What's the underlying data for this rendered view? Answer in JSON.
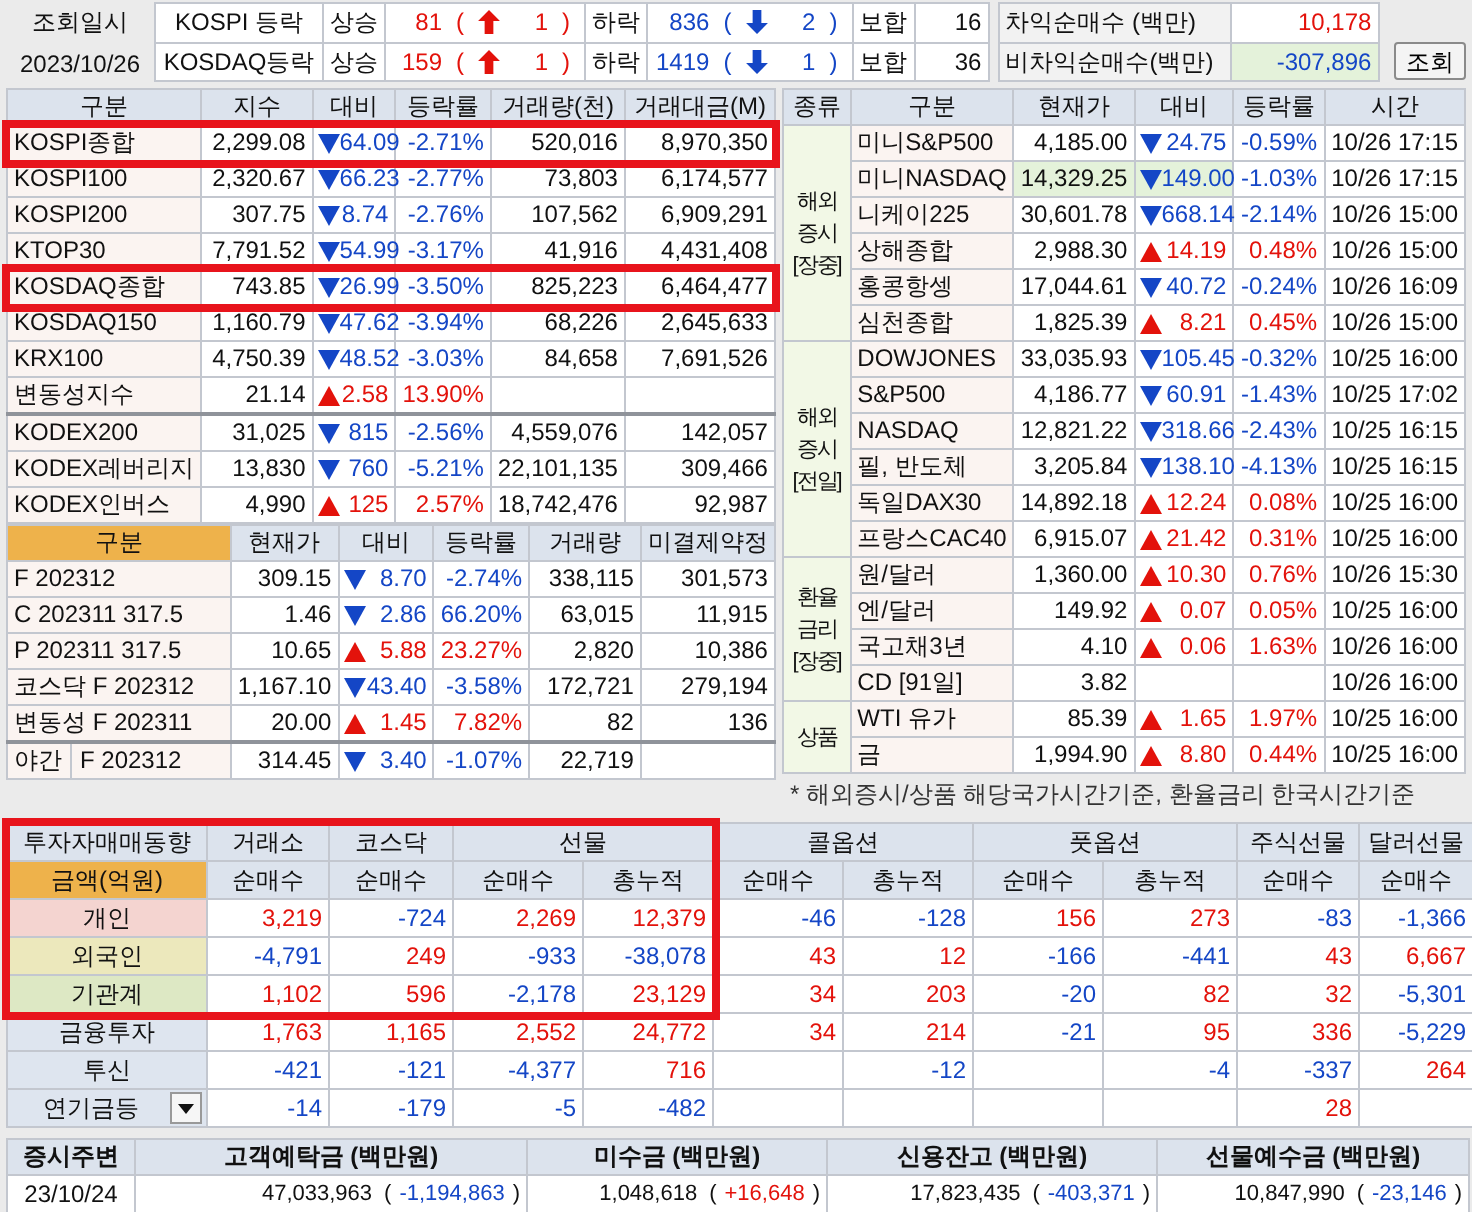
{
  "header": {
    "date_label": "조회일시",
    "date": "2023/10/26",
    "markets": [
      {
        "name": "KOSPI 등락",
        "up_label": "상승",
        "up": "81",
        "up_change": {
          "open": "(",
          "value": "1",
          "close": ")"
        },
        "down_label": "하락",
        "down": "836",
        "down_change": {
          "open": "(",
          "value": "2",
          "close": ")"
        },
        "flat_label": "보합",
        "flat": "16"
      },
      {
        "name": "KOSDAQ등락",
        "up_label": "상승",
        "up": "159",
        "up_change": {
          "open": "(",
          "value": "1",
          "close": ")"
        },
        "down_label": "하락",
        "down": "1419",
        "down_change": {
          "open": "(",
          "value": "1",
          "close": ")"
        },
        "flat_label": "보합",
        "flat": "36"
      }
    ],
    "arbitrage": [
      {
        "label": "차익순매수 (백만)",
        "value": "10,178",
        "rising": true,
        "highlighted": false
      },
      {
        "label": "비차익순매수(백만)",
        "value": "-307,896",
        "rising": false,
        "highlighted": true
      }
    ],
    "query_button": "조회"
  },
  "indices": {
    "columns": [
      "구분",
      "지수",
      "대비",
      "등락률",
      "거래량(천)",
      "거래대금(M)"
    ],
    "rows": [
      {
        "name": "KOSPI종합",
        "value": "2,299.08",
        "rising": false,
        "change": "64.09",
        "rate": "-2.71%",
        "volume": "520,016",
        "amount": "8,970,350",
        "highlighted": true,
        "separator": false
      },
      {
        "name": "KOSPI100",
        "value": "2,320.67",
        "rising": false,
        "change": "66.23",
        "rate": "-2.77%",
        "volume": "73,803",
        "amount": "6,174,577",
        "highlighted": false,
        "separator": false
      },
      {
        "name": "KOSPI200",
        "value": "307.75",
        "rising": false,
        "change": "8.74",
        "rate": "-2.76%",
        "volume": "107,562",
        "amount": "6,909,291",
        "highlighted": false,
        "separator": false
      },
      {
        "name": "KTOP30",
        "value": "7,791.52",
        "rising": false,
        "change": "54.99",
        "rate": "-3.17%",
        "volume": "41,916",
        "amount": "4,431,408",
        "highlighted": false,
        "separator": false
      },
      {
        "name": "KOSDAQ종합",
        "value": "743.85",
        "rising": false,
        "change": "26.99",
        "rate": "-3.50%",
        "volume": "825,223",
        "amount": "6,464,477",
        "highlighted": true,
        "separator": false
      },
      {
        "name": "KOSDAQ150",
        "value": "1,160.79",
        "rising": false,
        "change": "47.62",
        "rate": "-3.94%",
        "volume": "68,226",
        "amount": "2,645,633",
        "highlighted": false,
        "separator": false
      },
      {
        "name": "KRX100",
        "value": "4,750.39",
        "rising": false,
        "change": "48.52",
        "rate": "-3.03%",
        "volume": "84,658",
        "amount": "7,691,526",
        "highlighted": false,
        "separator": false
      },
      {
        "name": "변동성지수",
        "value": "21.14",
        "rising": true,
        "change": "2.58",
        "rate": "13.90%",
        "highlighted": false,
        "separator": false
      },
      {
        "name": "KODEX200",
        "value": "31,025",
        "rising": false,
        "change": "815",
        "rate": "-2.56%",
        "volume": "4,559,076",
        "amount": "142,057",
        "highlighted": false,
        "separator": true
      },
      {
        "name": "KODEX레버리지",
        "value": "13,830",
        "rising": false,
        "change": "760",
        "rate": "-5.21%",
        "volume": "22,101,135",
        "amount": "309,466",
        "highlighted": false,
        "separator": false
      },
      {
        "name": "KODEX인버스",
        "value": "4,990",
        "rising": true,
        "change": "125",
        "rate": "2.57%",
        "volume": "18,742,476",
        "amount": "92,987",
        "highlighted": false,
        "separator": false
      }
    ]
  },
  "futures": {
    "columns": [
      "구분",
      "현재가",
      "대비",
      "등락률",
      "거래량",
      "미결제약정"
    ],
    "rows": [
      {
        "name": "F 202312",
        "value": "309.15",
        "rising": false,
        "change": "8.70",
        "rate": "-2.74%",
        "volume": "338,115",
        "open_interest": "301,573",
        "separator": false
      },
      {
        "name": "C 202311 317.5",
        "value": "1.46",
        "rising": false,
        "change": "2.86",
        "rate": "66.20%",
        "volume": "63,015",
        "open_interest": "11,915",
        "separator": false
      },
      {
        "name": "P 202311 317.5",
        "value": "10.65",
        "rising": true,
        "change": "5.88",
        "rate": "23.27%",
        "volume": "2,820",
        "open_interest": "10,386",
        "separator": false
      },
      {
        "name": "코스닥 F 202312",
        "value": "1,167.10",
        "rising": false,
        "change": "43.40",
        "rate": "-3.58%",
        "volume": "172,721",
        "open_interest": "279,194",
        "separator": false
      },
      {
        "name": "변동성 F 202311",
        "value": "20.00",
        "rising": true,
        "change": "1.45",
        "rate": "7.82%",
        "volume": "82",
        "open_interest": "136",
        "separator": false
      },
      {
        "session": "야간",
        "name": "F 202312",
        "value": "314.45",
        "rising": false,
        "change": "3.40",
        "rate": "-1.07%",
        "volume": "22,719",
        "separator": true
      }
    ]
  },
  "global": {
    "columns": [
      "종류",
      "구분",
      "현재가",
      "대비",
      "등락률",
      "시간"
    ],
    "groups": [
      {
        "label": "해외\n증시\n[장중]",
        "rows": [
          {
            "name": "미니S&P500",
            "value": "4,185.00",
            "rising": false,
            "change": "24.75",
            "rate": "-0.59%",
            "time": "10/26 17:15",
            "flash": false
          },
          {
            "name": "미니NASDAQ",
            "value": "14,329.25",
            "rising": false,
            "change": "149.00",
            "rate": "-1.03%",
            "time": "10/26 17:15",
            "flash": true
          },
          {
            "name": "니케이225",
            "value": "30,601.78",
            "rising": false,
            "change": "668.14",
            "rate": "-2.14%",
            "time": "10/26 15:00",
            "flash": false
          },
          {
            "name": "상해종합",
            "value": "2,988.30",
            "rising": true,
            "change": "14.19",
            "rate": "0.48%",
            "time": "10/26 15:00",
            "flash": false
          },
          {
            "name": "홍콩항셍",
            "value": "17,044.61",
            "rising": false,
            "change": "40.72",
            "rate": "-0.24%",
            "time": "10/26 16:09",
            "flash": false
          },
          {
            "name": "심천종합",
            "value": "1,825.39",
            "rising": true,
            "change": "8.21",
            "rate": "0.45%",
            "time": "10/26 15:00",
            "flash": false
          }
        ]
      },
      {
        "label": "해외\n증시\n[전일]",
        "rows": [
          {
            "name": "DOWJONES",
            "value": "33,035.93",
            "rising": false,
            "change": "105.45",
            "rate": "-0.32%",
            "time": "10/25 16:00",
            "flash": false
          },
          {
            "name": "S&P500",
            "value": "4,186.77",
            "rising": false,
            "change": "60.91",
            "rate": "-1.43%",
            "time": "10/25 17:02",
            "flash": false
          },
          {
            "name": "NASDAQ",
            "value": "12,821.22",
            "rising": false,
            "change": "318.66",
            "rate": "-2.43%",
            "time": "10/25 16:15",
            "flash": false
          },
          {
            "name": "필, 반도체",
            "value": "3,205.84",
            "rising": false,
            "change": "138.10",
            "rate": "-4.13%",
            "time": "10/25 16:15",
            "flash": false
          },
          {
            "name": "독일DAX30",
            "value": "14,892.18",
            "rising": true,
            "change": "12.24",
            "rate": "0.08%",
            "time": "10/25 16:00",
            "flash": false
          },
          {
            "name": "프랑스CAC40",
            "value": "6,915.07",
            "rising": true,
            "change": "21.42",
            "rate": "0.31%",
            "time": "10/25 16:00",
            "flash": false
          }
        ]
      },
      {
        "label": "환율\n금리\n[장중]",
        "rows": [
          {
            "name": "원/달러",
            "value": "1,360.00",
            "rising": true,
            "change": "10.30",
            "rate": "0.76%",
            "time": "10/26 15:30",
            "flash": false
          },
          {
            "name": "엔/달러",
            "value": "149.92",
            "rising": true,
            "change": "0.07",
            "rate": "0.05%",
            "time": "10/25 16:00",
            "flash": false
          },
          {
            "name": "국고채3년",
            "value": "4.10",
            "rising": true,
            "change": "0.06",
            "rate": "1.63%",
            "time": "10/26 16:00",
            "flash": false
          },
          {
            "name": "CD [91일]",
            "value": "3.82",
            "time": "10/26 16:00",
            "flash": false
          }
        ]
      },
      {
        "label": "상품",
        "rows": [
          {
            "name": "WTI 유가",
            "value": "85.39",
            "rising": true,
            "change": "1.65",
            "rate": "1.97%",
            "time": "10/25 16:00",
            "flash": false
          },
          {
            "name": "금",
            "value": "1,994.90",
            "rising": true,
            "change": "8.80",
            "rate": "0.44%",
            "time": "10/25 16:00",
            "flash": false
          }
        ]
      }
    ],
    "note": "* 해외증시/상품 해당국가시간기준, 환율금리 한국시간기준"
  },
  "investor": {
    "title": "투자자매매동향",
    "unit": "금액(억원)",
    "highlighted": true,
    "groups": [
      {
        "label": "거래소",
        "columns": [
          "순매수"
        ]
      },
      {
        "label": "코스닥",
        "columns": [
          "순매수"
        ]
      },
      {
        "label": "선물",
        "columns": [
          "순매수",
          "총누적"
        ]
      },
      {
        "label": "콜옵션",
        "columns": [
          "순매수",
          "총누적"
        ]
      },
      {
        "label": "풋옵션",
        "columns": [
          "순매수",
          "총누적"
        ]
      },
      {
        "label": "주식선물",
        "columns": [
          "순매수"
        ]
      },
      {
        "label": "달러선물",
        "columns": [
          "순매수"
        ]
      }
    ],
    "rows": [
      {
        "name": "개인",
        "color": "#f4d4d0",
        "dropdown": false,
        "values": {
          "exchange_net": "3,219",
          "kosdaq_net": "-724",
          "futures_net": "2,269",
          "futures_total": "12,379",
          "call_net": "-46",
          "call_total": "-128",
          "put_net": "156",
          "put_total": "273",
          "stock_futures_net": "-83",
          "dollar_futures_net": "-1,366"
        }
      },
      {
        "name": "외국인",
        "color": "#ece8bc",
        "dropdown": false,
        "values": {
          "exchange_net": "-4,791",
          "kosdaq_net": "249",
          "futures_net": "-933",
          "futures_total": "-38,078",
          "call_net": "43",
          "call_total": "12",
          "put_net": "-166",
          "put_total": "-441",
          "stock_futures_net": "43",
          "dollar_futures_net": "6,667"
        }
      },
      {
        "name": "기관계",
        "color": "#dde8c4",
        "dropdown": false,
        "values": {
          "exchange_net": "1,102",
          "kosdaq_net": "596",
          "futures_net": "-2,178",
          "futures_total": "23,129",
          "call_net": "34",
          "call_total": "203",
          "put_net": "-20",
          "put_total": "82",
          "stock_futures_net": "32",
          "dollar_futures_net": "-5,301"
        }
      },
      {
        "name": "금융투자",
        "color": "#dee5ef",
        "dropdown": false,
        "values": {
          "exchange_net": "1,763",
          "kosdaq_net": "1,165",
          "futures_net": "2,552",
          "futures_total": "24,772",
          "call_net": "34",
          "call_total": "214",
          "put_net": "-21",
          "put_total": "95",
          "stock_futures_net": "336",
          "dollar_futures_net": "-5,229"
        }
      },
      {
        "name": "투신",
        "color": "#dee5ef",
        "dropdown": false,
        "values": {
          "exchange_net": "-421",
          "kosdaq_net": "-121",
          "futures_net": "-4,377",
          "futures_total": "716",
          "call_total": "-12",
          "put_total": "-4",
          "stock_futures_net": "-337",
          "dollar_futures_net": "264"
        }
      },
      {
        "name": "연기금등",
        "color": "#dee5ef",
        "dropdown": true,
        "values": {
          "exchange_net": "-14",
          "kosdaq_net": "-179",
          "futures_net": "-5",
          "futures_total": "-482",
          "stock_futures_net": "28"
        }
      }
    ]
  },
  "summary": {
    "label": "증시주변",
    "date": "23/10/24",
    "items": [
      {
        "label": "고객예탁금 (백만원)",
        "value": "47,033,963",
        "change": {
          "open": "(",
          "value": "-1,194,863",
          "close": ")"
        },
        "rising": false
      },
      {
        "label": "미수금 (백만원)",
        "value": "1,048,618",
        "change": {
          "open": "(",
          "value": "+16,648",
          "close": ")"
        },
        "rising": true
      },
      {
        "label": "신용잔고 (백만원)",
        "value": "17,823,435",
        "change": {
          "open": "(",
          "value": "-403,371",
          "close": ")"
        },
        "rising": false
      },
      {
        "label": "선물예수금 (백만원)",
        "value": "10,847,990",
        "change": {
          "open": "(",
          "value": "-23,146",
          "close": ")"
        },
        "rising": false
      }
    ]
  }
}
